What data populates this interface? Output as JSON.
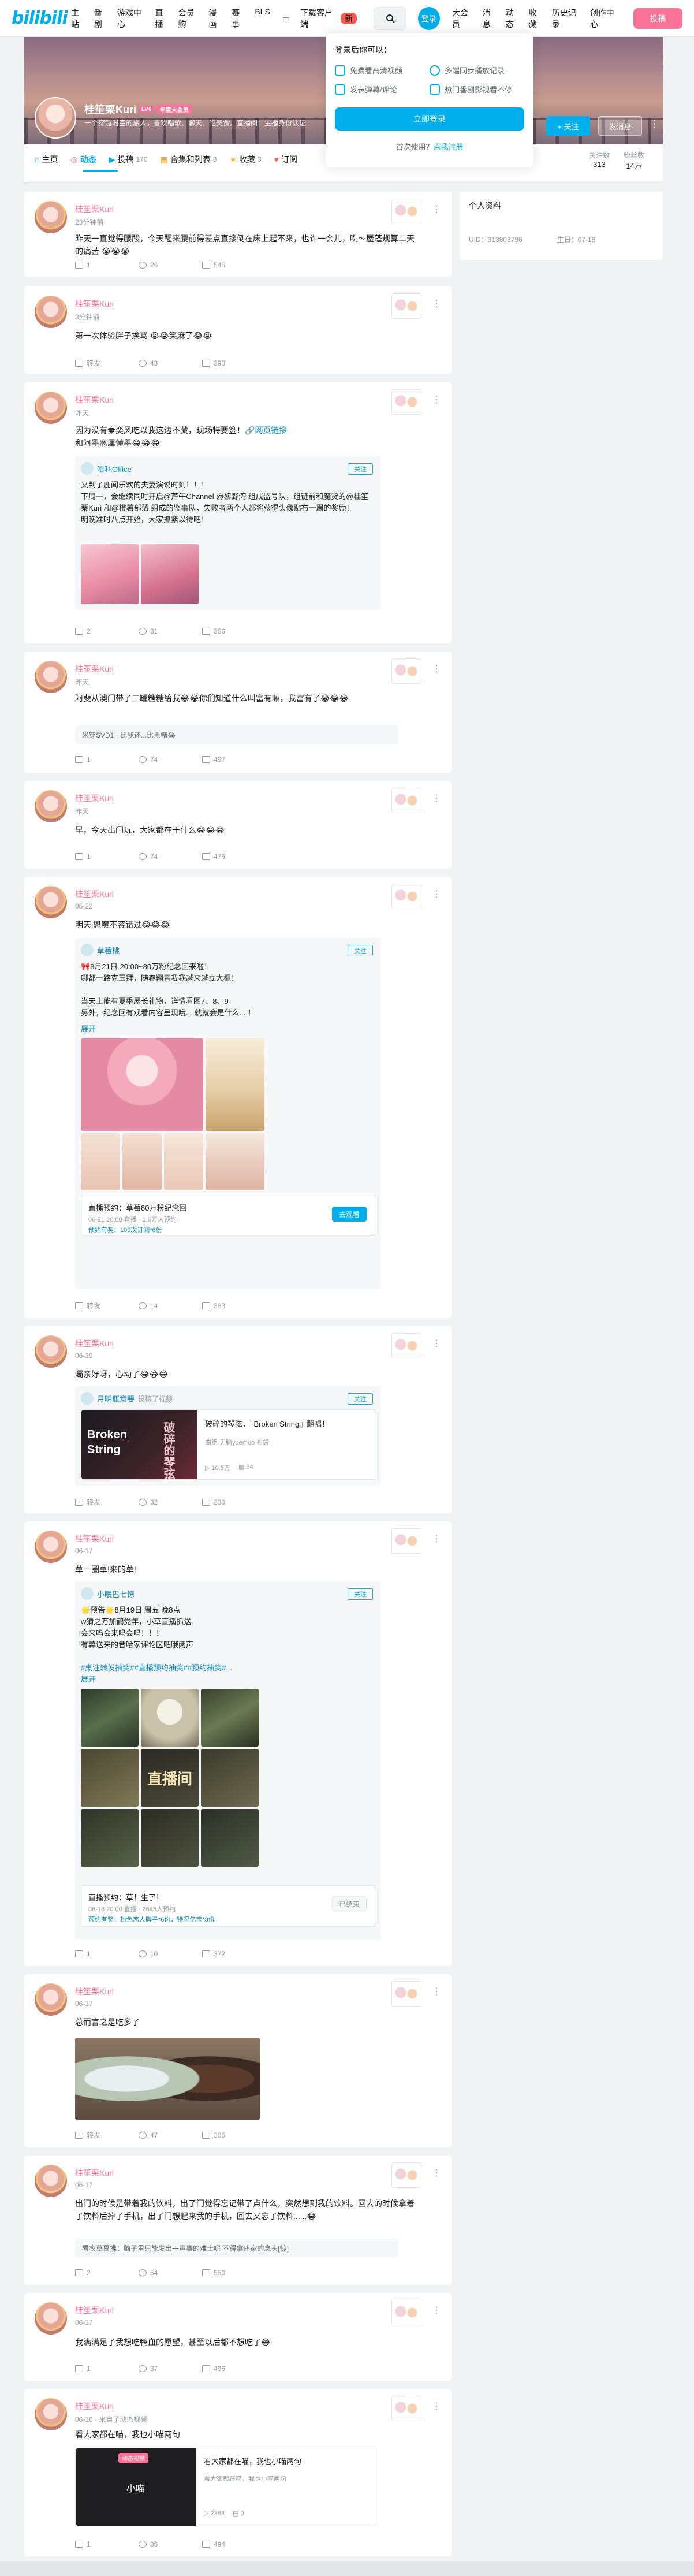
{
  "nav": {
    "logo": "bilibili",
    "left": [
      "主站",
      "番剧",
      "游戏中心",
      "直播",
      "会员购",
      "漫画",
      "赛事",
      "BLS"
    ],
    "download": "下载客户端",
    "download_badge": "新",
    "login": "登录",
    "right": [
      "大会员",
      "消息",
      "动态",
      "收藏",
      "历史记录",
      "创作中心"
    ],
    "upload": "投稿"
  },
  "profile": {
    "name": "桂笙栗Kuri",
    "level": "LV6",
    "vip": "年度大会员",
    "sign": "一个穿越时空的旅人，喜欢唱歌、聊天、吃美食。直播间：主播身份认证",
    "follow": "+ 关注",
    "message": "发消息",
    "more": "⋮"
  },
  "tabs": [
    {
      "label": "主页",
      "count": ""
    },
    {
      "label": "动态",
      "count": ""
    },
    {
      "label": "投稿",
      "count": "170"
    },
    {
      "label": "合集和列表",
      "count": "3"
    },
    {
      "label": "收藏",
      "count": "3"
    },
    {
      "label": "订阅",
      "count": ""
    }
  ],
  "stats": [
    {
      "label": "关注数",
      "value": "313"
    },
    {
      "label": "粉丝数",
      "value": "14万"
    }
  ],
  "popover": {
    "title": "登录后你可以：",
    "items": [
      "免费看高清视频",
      "多端同步播放记录",
      "发表弹幕/评论",
      "热门番剧影视看不停"
    ],
    "button": "立即登录",
    "first_use": "首次使用？",
    "register": "点我注册"
  },
  "side": {
    "title": "个人资料",
    "uid": "UID：313803796",
    "birthday": "生日：07-18"
  },
  "posts": [
    {
      "name": "桂笙栗Kuri",
      "time": "23分钟前",
      "text": "昨天一直觉得腰酸，今天醒来腰前得差点直接倒在床上起不来，也许一会儿，咧～屋蓬规算二天的痛苦 😭😭😭",
      "share": "1",
      "comment": "26",
      "like": "545"
    },
    {
      "name": "桂笙栗Kuri",
      "time": "3分钟前",
      "text": "第一次体验胖子挨骂 😭😭笑麻了😭😭",
      "share": "转发",
      "comment": "43",
      "like": "390"
    },
    {
      "name": "桂笙栗Kuri",
      "time": "昨天",
      "text": "因为没有秦奕风吃以我这边不藏，现场特要签！",
      "link": "网页链接",
      "text2": "和阿墨离属懂墨😂😂😂",
      "repost_user": "哈利Office",
      "repost_follow": "关注",
      "repost_text": [
        "又到了鹿闻乐欢的夫妻演说时刻！！！",
        "下周一，会继续同时开启@芹午Channel @黎野湾 组成监号队，组链前和魔货的@桂笙栗Kuri 和@橙薯部落 组成的鉴事队，失败者两个人都将获得头像贴布一周的奖励！",
        "明晚准时八点开始，大家抓紧以待吧！"
      ],
      "share": "2",
      "comment": "31",
      "like": "356"
    },
    {
      "name": "桂笙栗Kuri",
      "time": "昨天",
      "text": "阿斐从澳门带了三罐糖糖给我😂😂你们知道什么叫富有嘛，我富有了😂😂😂",
      "comment_line": "米穿SVD1 · 比我还...比黑糖😂",
      "share": "1",
      "comment": "74",
      "like": "497"
    },
    {
      "name": "桂笙栗Kuri",
      "time": "昨天",
      "text": "早，今天出门玩，大家都在干什么😂😂😂",
      "share": "1",
      "comment": "74",
      "like": "476"
    },
    {
      "name": "桂笙栗Kuri",
      "time": "06-22",
      "text": "明天i恩魔不容错过😂😂😂",
      "repost_user": "草莓桃",
      "repost_follow": "关注",
      "repost_text": [
        "🎀8月21日 20:00~80万粉纪念回来啦！",
        "哪都一路克玉拜，随春翔青我我越来越立大棍！",
        "",
        "当天上能有夏季展长礼物，详情看图7、8、9",
        "另外，纪念回有观看内容呈现哦....就就会是什么....！"
      ],
      "expand": "展开",
      "reserve_title": "直播预约：草莓80万粉纪念回",
      "reserve_meta": "06-21 20:00 直播 · 1.6万人预约",
      "reserve_sub": "预约有奖：100次订阅*6份",
      "reserve_btn": "去观看",
      "share": "转发",
      "comment": "14",
      "like": "383"
    },
    {
      "name": "桂笙栗Kuri",
      "time": "06-19",
      "text": "灞亲好呀，心动了😂😂😂",
      "repost_user": "月明瓶意要",
      "repost_sub": "投稿了视频",
      "repost_follow": "关注",
      "video_title": "破碎的琴弦，『Broken String』翻唱！",
      "video_tag": "曲组 无脑yuemuo 布袋",
      "video_cover_text": "Broken String",
      "video_cover_cn": "破碎的琴弦",
      "video_views": "10.5万",
      "video_danmaku": "84",
      "share": "转发",
      "comment": "32",
      "like": "230"
    },
    {
      "name": "桂笙栗Kuri",
      "time": "06-17",
      "text": "草一圈草!来的草!",
      "repost_user": "小眠巴七惊",
      "repost_follow": "关注",
      "repost_text": [
        "🌟预告🌟8月19日 周五 晚8点",
        "w猜之万加鹤党年，小草直播抓送",
        "会来吗会来吗会吗！！！",
        "有幕送来的昔哈家评论区吧哦两声"
      ],
      "hashtags": "#桌注转发抽奖##直播预约抽奖##预约抽奖#...",
      "expand": "展开",
      "poster_text": "直播间",
      "reserve_title": "直播预约：草！生了！",
      "reserve_meta": "06-18 20:00 直播 · 2645人预约",
      "reserve_sub": "预约有奖：粉色恋人牌子*6份，特况亿宝*3份",
      "reserve_btn": "已结束",
      "share": "1",
      "comment": "10",
      "like": "372"
    },
    {
      "name": "桂笙栗Kuri",
      "time": "06-17",
      "text": "总而言之是吃多了",
      "share": "转发",
      "comment": "47",
      "like": "305"
    },
    {
      "name": "桂笙栗Kuri",
      "time": "06-17",
      "text": "出门的时候是带着我的饮料，出了门觉得忘记带了点什么，突然想到我的饮料。回去的时候拿着了饮料后掉了手机，出了门想起来我的手机，回去又忘了饮料......😂",
      "comment_line": "看农草慕拂：脑子里只能发出一声事的难士呢 不得拿违家的念头[惊]",
      "share": "2",
      "comment": "54",
      "like": "550"
    },
    {
      "name": "桂笙栗Kuri",
      "time": "06-17",
      "text": "我满满足了我想吃鸭血的愿望，甚至以后都不想吃了😂",
      "share": "1",
      "comment": "37",
      "like": "496"
    },
    {
      "name": "桂笙栗Kuri",
      "time": "06-16 · 来自了动态视频",
      "text": "看大家都在喵，我也小喵两句",
      "video_title": "看大家都在喵，我也小喵两句",
      "video_tag": "看大家都在喵，我也小喵两句",
      "video_cover_text": "小喵",
      "video_badge": "动态视频",
      "video_views": "2383",
      "video_danmaku": "0",
      "share": "1",
      "comment": "36",
      "like": "494"
    }
  ]
}
